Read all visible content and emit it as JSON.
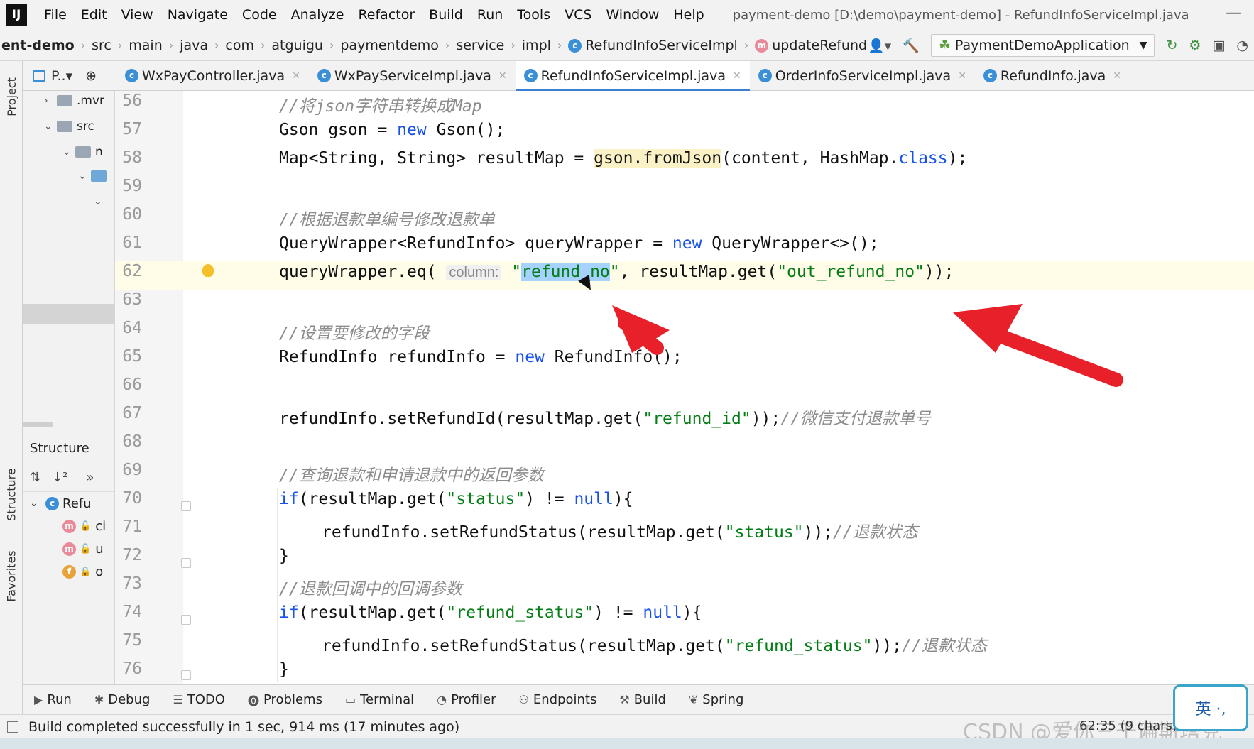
{
  "window": {
    "app_icon": "IJ",
    "title": "payment-demo [D:\\demo\\payment-demo] - RefundInfoServiceImpl.java",
    "minimize": "—"
  },
  "menu": [
    "File",
    "Edit",
    "View",
    "Navigate",
    "Code",
    "Analyze",
    "Refactor",
    "Build",
    "Run",
    "Tools",
    "VCS",
    "Window",
    "Help"
  ],
  "breadcrumb": {
    "project": "ent-demo",
    "items": [
      "src",
      "main",
      "java",
      "com",
      "atguigu",
      "paymentdemo",
      "service",
      "impl"
    ],
    "class": "RefundInfoServiceImpl",
    "method": "updateRefund"
  },
  "run_config": "PaymentDemoApplication",
  "tabs": {
    "project_tool": "P..▾",
    "items": [
      "WxPayController.java",
      "WxPayServiceImpl.java",
      "RefundInfoServiceImpl.java",
      "OrderInfoServiceImpl.java",
      "RefundInfo.java"
    ],
    "active_index": 2
  },
  "left_strip": {
    "project": "Project",
    "structure": "Structure",
    "favorites": "Favorites"
  },
  "project_tree": [
    {
      "label": ".mvr"
    },
    {
      "label": "src"
    },
    {
      "label": "n"
    }
  ],
  "structure": {
    "title": "Structure",
    "root": "Refu",
    "members": [
      {
        "badge": "m",
        "label": "ci"
      },
      {
        "badge": "m",
        "label": "u"
      },
      {
        "badge": "f",
        "label": "o"
      }
    ]
  },
  "code": {
    "line_numbers": [
      "56",
      "57",
      "58",
      "59",
      "60",
      "61",
      "62",
      "63",
      "64",
      "65",
      "66",
      "67",
      "68",
      "69",
      "70",
      "71",
      "72",
      "73",
      "74",
      "75",
      "76"
    ],
    "l56_cm": "//将json字符串转换成Map",
    "l57_a": "Gson gson = ",
    "l57_kw": "new",
    "l57_b": " Gson();",
    "l58_a": "Map<String, String> resultMap = ",
    "l58_hl": "gson.fromJson",
    "l58_b": "(content, HashMap.",
    "l58_kw": "class",
    "l58_c": ");",
    "l60_cm": "//根据退款单编号修改退款单",
    "l61_a": "QueryWrapper<RefundInfo> queryWrapper = ",
    "l61_kw": "new",
    "l61_b": " QueryWrapper<>();",
    "l62_a": "queryWrapper.eq( ",
    "l62_hint": "column:",
    "l62_q1": " \"",
    "l62_sel": "refund_no",
    "l62_q2": "\"",
    "l62_b": ", resultMap.get(",
    "l62_str": "\"out_refund_no\"",
    "l62_c": "));",
    "l64_cm": "//设置要修改的字段",
    "l65_a": "RefundInfo refundInfo = ",
    "l65_kw": "new",
    "l65_b": " RefundInfo();",
    "l67_a": "refundInfo.setRefundId(resultMap.get(",
    "l67_str": "\"refund_id\"",
    "l67_b": "));",
    "l67_cm": "//微信支付退款单号",
    "l69_cm": "//查询退款和申请退款中的返回参数",
    "l70_kw": "if",
    "l70_a": "(resultMap.get(",
    "l70_str": "\"status\"",
    "l70_b": ") != ",
    "l70_kw2": "null",
    "l70_c": "){",
    "l71_a": "refundInfo.setRefundStatus(resultMap.get(",
    "l71_str": "\"status\"",
    "l71_b": "));",
    "l71_cm": "//退款状态",
    "l72": "}",
    "l73_cm": "//退款回调中的回调参数",
    "l74_kw": "if",
    "l74_a": "(resultMap.get(",
    "l74_str": "\"refund_status\"",
    "l74_b": ") != ",
    "l74_kw2": "null",
    "l74_c": "){",
    "l75_a": "refundInfo.setRefundStatus(resultMap.get(",
    "l75_str": "\"refund_status\"",
    "l75_b": "));",
    "l75_cm": "//退款状态",
    "l76": "}"
  },
  "tool_windows": [
    "Run",
    "Debug",
    "TODO",
    "Problems",
    "Terminal",
    "Profiler",
    "Endpoints",
    "Build",
    "Spring"
  ],
  "status": {
    "message": "Build completed successfully in 1 sec, 914 ms (17 minutes ago)",
    "position": "62:35 (9 chars)"
  },
  "ime": "英 ·,",
  "watermark": "CSDN @爱你三千遍斯塔克"
}
